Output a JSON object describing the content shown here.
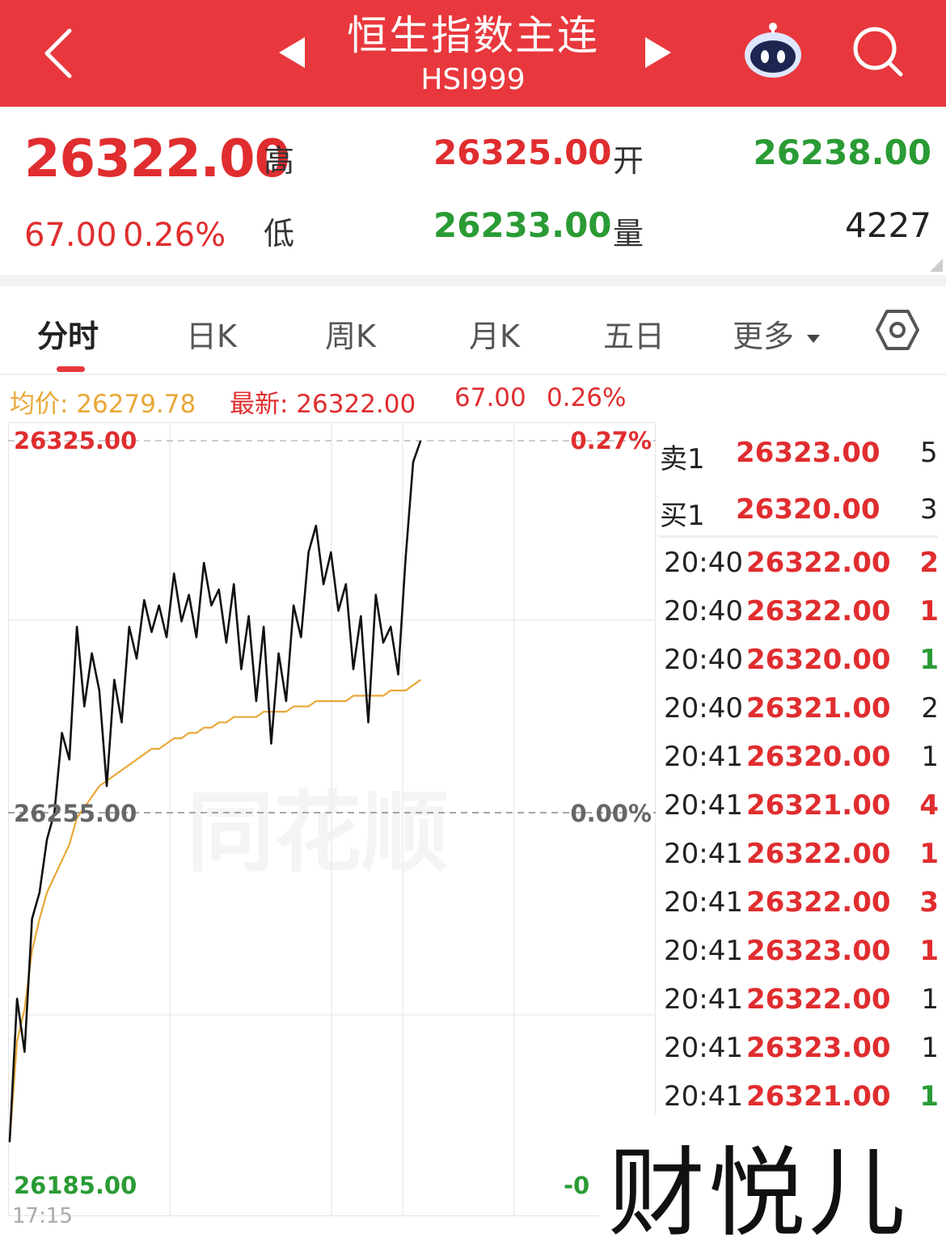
{
  "header": {
    "title": "恒生指数主连",
    "code": "HSI999"
  },
  "quote": {
    "price": "26322.00",
    "change": "67.00",
    "change_pct": "0.26%",
    "high_label": "高",
    "high": "26325.00",
    "open_label": "开",
    "open": "26238.00",
    "low_label": "低",
    "low": "26233.00",
    "volume_label": "量",
    "volume": "4227"
  },
  "tabs": [
    {
      "label": "分时"
    },
    {
      "label": "日K"
    },
    {
      "label": "周K"
    },
    {
      "label": "月K"
    },
    {
      "label": "五日"
    },
    {
      "label": "更多"
    }
  ],
  "info_bar": {
    "avg_text": "均价: 26279.78",
    "latest_text": "最新: 26322.00",
    "latest_change": "67.00",
    "latest_pct": "0.26%"
  },
  "orderbook": {
    "sell_label": "卖1",
    "sell_price": "26323.00",
    "sell_vol": "5",
    "buy_label": "买1",
    "buy_price": "26320.00",
    "buy_vol": "3"
  },
  "ticks": [
    {
      "time": "20:40",
      "price": "26322.00",
      "vol": "2",
      "vol_color": "red"
    },
    {
      "time": "20:40",
      "price": "26322.00",
      "vol": "1",
      "vol_color": "red"
    },
    {
      "time": "20:40",
      "price": "26320.00",
      "vol": "1",
      "vol_color": "green"
    },
    {
      "time": "20:40",
      "price": "26321.00",
      "vol": "2",
      "vol_color": "dark"
    },
    {
      "time": "20:41",
      "price": "26320.00",
      "vol": "1",
      "vol_color": "dark"
    },
    {
      "time": "20:41",
      "price": "26321.00",
      "vol": "4",
      "vol_color": "red"
    },
    {
      "time": "20:41",
      "price": "26322.00",
      "vol": "1",
      "vol_color": "red"
    },
    {
      "time": "20:41",
      "price": "26322.00",
      "vol": "3",
      "vol_color": "red"
    },
    {
      "time": "20:41",
      "price": "26323.00",
      "vol": "1",
      "vol_color": "red"
    },
    {
      "time": "20:41",
      "price": "26322.00",
      "vol": "1",
      "vol_color": "dark"
    },
    {
      "time": "20:41",
      "price": "26323.00",
      "vol": "1",
      "vol_color": "dark"
    },
    {
      "time": "20:41",
      "price": "26321.00",
      "vol": "1",
      "vol_color": "green"
    }
  ],
  "chart_labels": {
    "top_price": "26325.00",
    "top_pct": "0.27%",
    "mid_price": "26255.00",
    "mid_pct": "0.00%",
    "bottom_price": "26185.00",
    "bottom_pct": "-0",
    "time_start": "17:15"
  },
  "watermark": "同花顺",
  "brand": "财悦儿",
  "colors": {
    "header_bg": "#e8383d",
    "up": "#e02d2f",
    "down": "#2a9b35",
    "avg_line": "#e8a838",
    "price_line": "#111111"
  },
  "icons": {
    "back": "back-chevron-icon",
    "prev": "prev-triangle-icon",
    "next": "next-triangle-icon",
    "robot": "robot-assistant-icon",
    "search": "search-icon",
    "settings": "settings-hexagon-icon",
    "dropdown": "dropdown-caret-icon"
  },
  "chart_data": {
    "type": "line",
    "ylim": [
      26185,
      26325
    ],
    "xlim": [
      0,
      268
    ],
    "series": [
      {
        "values": [
          26193,
          26220,
          26210,
          26235,
          26240,
          26250,
          26255,
          26270,
          26265,
          26290,
          26275,
          26285,
          26278,
          26260,
          26280,
          26272,
          26290,
          26284,
          26295,
          26289,
          26294,
          26288,
          26300,
          26291,
          26296,
          26288,
          26302,
          26294,
          26297,
          26287,
          26298,
          26282,
          26292,
          26276,
          26290,
          26268,
          26285,
          26276,
          26294,
          26288,
          26304,
          26309,
          26298,
          26304,
          26293,
          26298,
          26282,
          26292,
          26272,
          26296,
          26287,
          26290,
          26281,
          26303,
          26321,
          26325
        ]
      },
      {
        "name": "均价",
        "values": [
          26193,
          26212,
          26218,
          26229,
          26235,
          26240,
          26243,
          26246,
          26249,
          26254,
          26256,
          26258,
          26260,
          26261,
          26262,
          26263,
          26264,
          26265,
          26266,
          26267,
          26267,
          26268,
          26269,
          26269,
          26270,
          26270,
          26271,
          26271,
          26272,
          26272,
          26273,
          26273,
          26273,
          26273,
          26274,
          26274,
          26274,
          26274,
          26275,
          26275,
          26275,
          26276,
          26276,
          26276,
          26276,
          26276,
          26277,
          26277,
          26277,
          26277,
          26277,
          26278,
          26278,
          26278,
          26279,
          26280
        ]
      }
    ]
  }
}
